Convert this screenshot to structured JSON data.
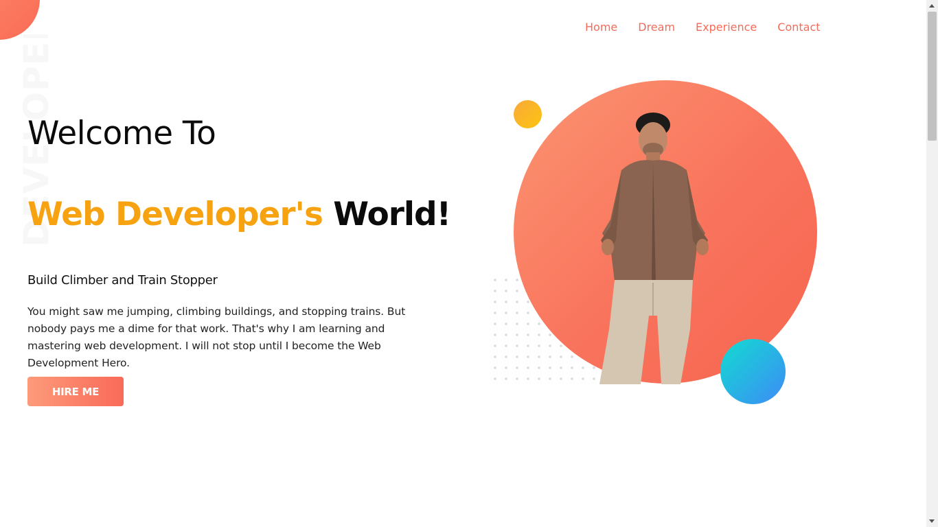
{
  "brand": {
    "vertical_word": "DEVELOPER"
  },
  "nav": {
    "items": [
      "Home",
      "Dream",
      "Experience",
      "Contact"
    ]
  },
  "hero": {
    "title_line1": "Welcome To",
    "title_accent": "Web Developer's",
    "title_rest": " World!",
    "subtitle": "Build Climber and Train Stopper",
    "body": "You might saw me jumping, climbing buildings, and stopping trains. But nobody pays me a dime for that work. That's why I am learning and mastering web development. I will not stop until I become the Web Development Hero.",
    "cta": "HIRE ME"
  },
  "colors": {
    "accent": "#f56b57",
    "highlight": "#f7a311",
    "circle_gradient": [
      "#fb9471",
      "#f66550"
    ],
    "blue_gradient": [
      "#12dcd0",
      "#3d8bf7"
    ],
    "yellow_gradient": [
      "#f9a93a",
      "#fcc411"
    ]
  },
  "icons": {
    "profile": "person-photo"
  }
}
